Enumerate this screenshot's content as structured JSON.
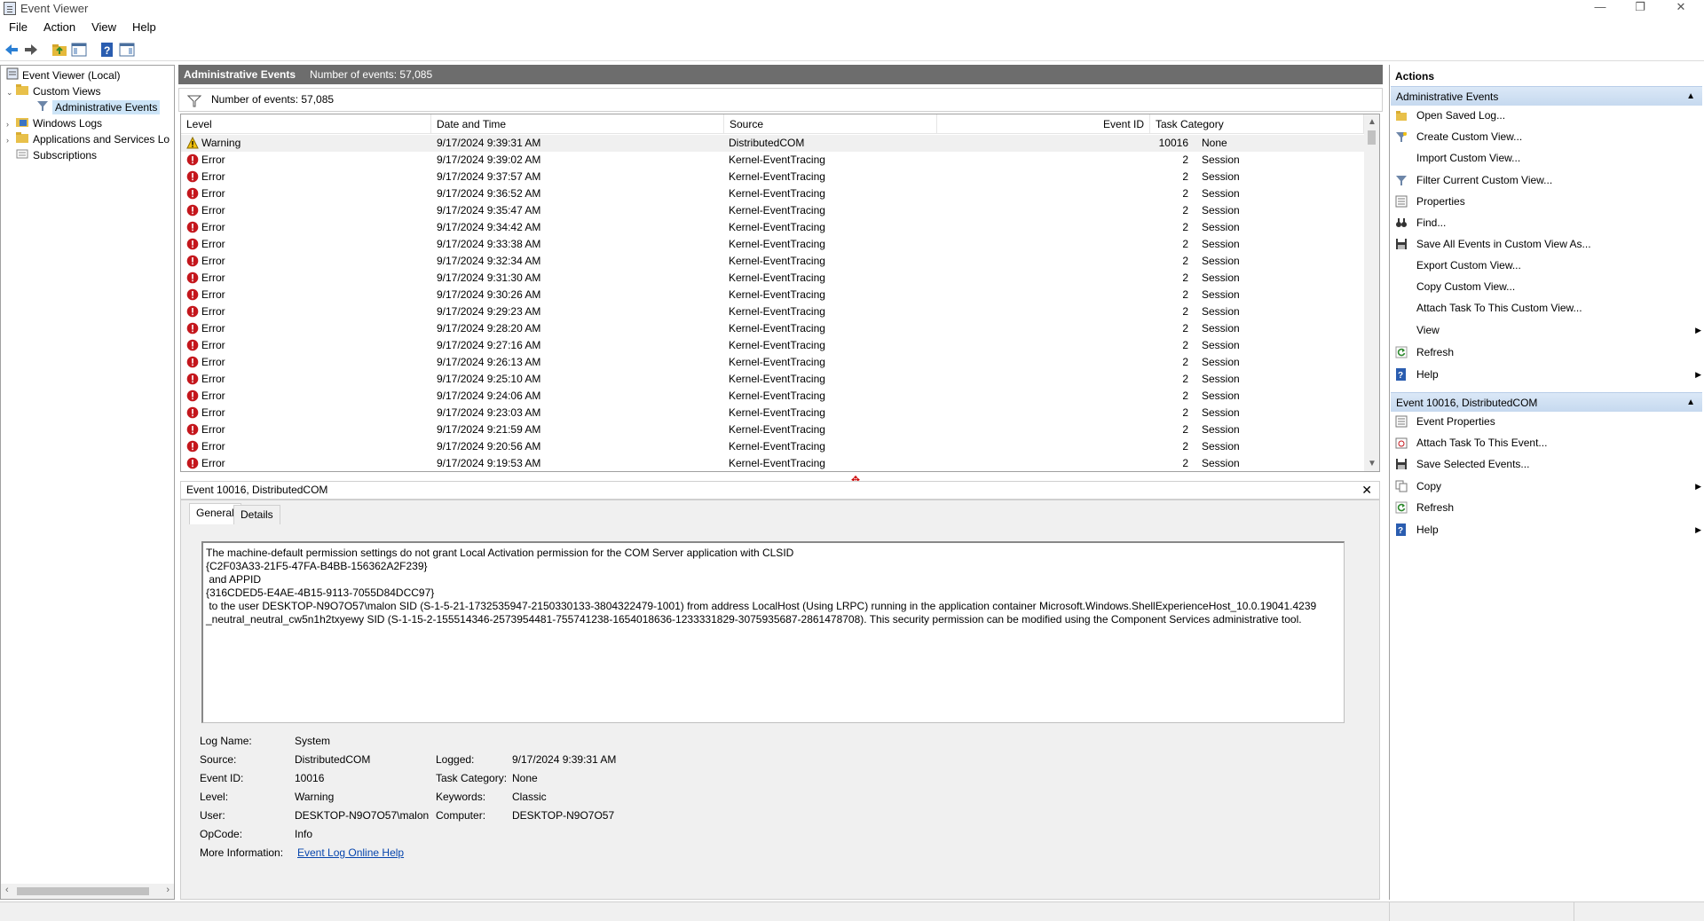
{
  "window": {
    "title": "Event Viewer",
    "minimize": "—",
    "restore": "❐",
    "close": "✕"
  },
  "menu": [
    "File",
    "Action",
    "View",
    "Help"
  ],
  "tree": {
    "root": "Event Viewer (Local)",
    "custom_views": "Custom Views",
    "admin_events": "Administrative Events",
    "windows_logs": "Windows Logs",
    "apps_services": "Applications and Services Lo",
    "subscriptions": "Subscriptions"
  },
  "center": {
    "title": "Administrative Events",
    "count": "Number of events: 57,085",
    "filter_count": "Number of events: 57,085"
  },
  "grid": {
    "columns": {
      "level": "Level",
      "date": "Date and Time",
      "source": "Source",
      "event_id": "Event ID",
      "category": "Task Category"
    },
    "rows": [
      {
        "level": "Warning",
        "date": "9/17/2024 9:39:31 AM",
        "source": "DistributedCOM",
        "id": "10016",
        "category": "None"
      },
      {
        "level": "Error",
        "date": "9/17/2024 9:39:02 AM",
        "source": "Kernel-EventTracing",
        "id": "2",
        "category": "Session"
      },
      {
        "level": "Error",
        "date": "9/17/2024 9:37:57 AM",
        "source": "Kernel-EventTracing",
        "id": "2",
        "category": "Session"
      },
      {
        "level": "Error",
        "date": "9/17/2024 9:36:52 AM",
        "source": "Kernel-EventTracing",
        "id": "2",
        "category": "Session"
      },
      {
        "level": "Error",
        "date": "9/17/2024 9:35:47 AM",
        "source": "Kernel-EventTracing",
        "id": "2",
        "category": "Session"
      },
      {
        "level": "Error",
        "date": "9/17/2024 9:34:42 AM",
        "source": "Kernel-EventTracing",
        "id": "2",
        "category": "Session"
      },
      {
        "level": "Error",
        "date": "9/17/2024 9:33:38 AM",
        "source": "Kernel-EventTracing",
        "id": "2",
        "category": "Session"
      },
      {
        "level": "Error",
        "date": "9/17/2024 9:32:34 AM",
        "source": "Kernel-EventTracing",
        "id": "2",
        "category": "Session"
      },
      {
        "level": "Error",
        "date": "9/17/2024 9:31:30 AM",
        "source": "Kernel-EventTracing",
        "id": "2",
        "category": "Session"
      },
      {
        "level": "Error",
        "date": "9/17/2024 9:30:26 AM",
        "source": "Kernel-EventTracing",
        "id": "2",
        "category": "Session"
      },
      {
        "level": "Error",
        "date": "9/17/2024 9:29:23 AM",
        "source": "Kernel-EventTracing",
        "id": "2",
        "category": "Session"
      },
      {
        "level": "Error",
        "date": "9/17/2024 9:28:20 AM",
        "source": "Kernel-EventTracing",
        "id": "2",
        "category": "Session"
      },
      {
        "level": "Error",
        "date": "9/17/2024 9:27:16 AM",
        "source": "Kernel-EventTracing",
        "id": "2",
        "category": "Session"
      },
      {
        "level": "Error",
        "date": "9/17/2024 9:26:13 AM",
        "source": "Kernel-EventTracing",
        "id": "2",
        "category": "Session"
      },
      {
        "level": "Error",
        "date": "9/17/2024 9:25:10 AM",
        "source": "Kernel-EventTracing",
        "id": "2",
        "category": "Session"
      },
      {
        "level": "Error",
        "date": "9/17/2024 9:24:06 AM",
        "source": "Kernel-EventTracing",
        "id": "2",
        "category": "Session"
      },
      {
        "level": "Error",
        "date": "9/17/2024 9:23:03 AM",
        "source": "Kernel-EventTracing",
        "id": "2",
        "category": "Session"
      },
      {
        "level": "Error",
        "date": "9/17/2024 9:21:59 AM",
        "source": "Kernel-EventTracing",
        "id": "2",
        "category": "Session"
      },
      {
        "level": "Error",
        "date": "9/17/2024 9:20:56 AM",
        "source": "Kernel-EventTracing",
        "id": "2",
        "category": "Session"
      },
      {
        "level": "Error",
        "date": "9/17/2024 9:19:53 AM",
        "source": "Kernel-EventTracing",
        "id": "2",
        "category": "Session"
      }
    ]
  },
  "detail": {
    "header": "Event 10016, DistributedCOM",
    "close": "✕",
    "tabs": {
      "general": "General",
      "details": "Details"
    },
    "description": "The machine-default permission settings do not grant Local Activation permission for the COM Server application with CLSID\n{C2F03A33-21F5-47FA-B4BB-156362A2F239}\n and APPID\n{316CDED5-E4AE-4B15-9113-7055D84DCC97}\n to the user DESKTOP-N9O7O57\\malon SID (S-1-5-21-1732535947-2150330133-3804322479-1001) from address LocalHost (Using LRPC) running in the application container Microsoft.Windows.ShellExperienceHost_10.0.19041.4239\n_neutral_neutral_cw5n1h2txyewy SID (S-1-15-2-155514346-2573954481-755741238-1654018636-1233331829-3075935687-2861478708). This security permission can be modified using the Component Services administrative tool.",
    "fields": {
      "log_name_label": "Log Name:",
      "log_name": "System",
      "source_label": "Source:",
      "source": "DistributedCOM",
      "logged_label": "Logged:",
      "logged": "9/17/2024 9:39:31 AM",
      "event_id_label": "Event ID:",
      "event_id": "10016",
      "task_cat_label": "Task Category:",
      "task_cat": "None",
      "level_label": "Level:",
      "level": "Warning",
      "keywords_label": "Keywords:",
      "keywords": "Classic",
      "user_label": "User:",
      "user": "DESKTOP-N9O7O57\\malon",
      "computer_label": "Computer:",
      "computer": "DESKTOP-N9O7O57",
      "opcode_label": "OpCode:",
      "opcode": "Info",
      "more_info_label": "More Information:",
      "more_info_link": "Event Log Online Help"
    }
  },
  "actions": {
    "header": "Actions",
    "section1": "Administrative Events",
    "items1": [
      {
        "label": "Open Saved Log...",
        "icon": "folder-open-icon"
      },
      {
        "label": "Create Custom View...",
        "icon": "filter-create-icon"
      },
      {
        "label": "Import Custom View...",
        "icon": "none"
      },
      {
        "label": "Filter Current Custom View...",
        "icon": "filter-icon"
      },
      {
        "label": "Properties",
        "icon": "properties-icon"
      },
      {
        "label": "Find...",
        "icon": "binoculars-icon"
      },
      {
        "label": "Save All Events in Custom View As...",
        "icon": "save-icon"
      },
      {
        "label": "Export Custom View...",
        "icon": "none"
      },
      {
        "label": "Copy Custom View...",
        "icon": "none"
      },
      {
        "label": "Attach Task To This Custom View...",
        "icon": "none"
      },
      {
        "label": "View",
        "icon": "none",
        "submenu": true
      },
      {
        "label": "Refresh",
        "icon": "refresh-icon"
      },
      {
        "label": "Help",
        "icon": "help-icon",
        "submenu": true
      }
    ],
    "section2": "Event 10016, DistributedCOM",
    "items2": [
      {
        "label": "Event Properties",
        "icon": "properties-icon"
      },
      {
        "label": "Attach Task To This Event...",
        "icon": "task-icon"
      },
      {
        "label": "Save Selected Events...",
        "icon": "save-icon"
      },
      {
        "label": "Copy",
        "icon": "copy-icon",
        "submenu": true
      },
      {
        "label": "Refresh",
        "icon": "refresh-icon"
      },
      {
        "label": "Help",
        "icon": "help-icon",
        "submenu": true
      }
    ]
  },
  "colors": {
    "header_bg": "#6d6d6d",
    "section_bg": "#c6d9ef",
    "error_red": "#c4161c",
    "warning_yellow": "#f4c20d",
    "link_blue": "#0645ad"
  }
}
